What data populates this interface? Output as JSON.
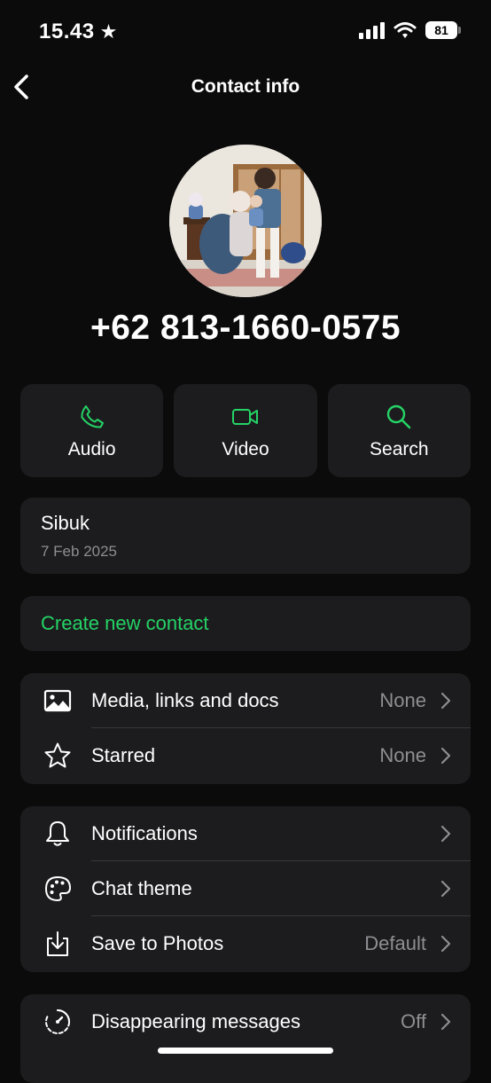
{
  "status_bar": {
    "time": "15.43",
    "battery": "81"
  },
  "nav": {
    "title": "Contact info"
  },
  "profile": {
    "phone": "+62 813-1660-0575"
  },
  "actions": [
    {
      "label": "Audio",
      "icon": "phone-icon"
    },
    {
      "label": "Video",
      "icon": "video-camera-icon"
    },
    {
      "label": "Search",
      "icon": "search-icon"
    }
  ],
  "about": {
    "status": "Sibuk",
    "date": "7 Feb 2025"
  },
  "create_contact": {
    "label": "Create new contact"
  },
  "group1": [
    {
      "label": "Media, links and docs",
      "value": "None",
      "icon": "image-icon"
    },
    {
      "label": "Starred",
      "value": "None",
      "icon": "star-icon"
    }
  ],
  "group2": [
    {
      "label": "Notifications",
      "value": "",
      "icon": "bell-icon"
    },
    {
      "label": "Chat theme",
      "value": "",
      "icon": "palette-icon"
    },
    {
      "label": "Save to Photos",
      "value": "Default",
      "icon": "download-tray-icon"
    }
  ],
  "group3": [
    {
      "label": "Disappearing messages",
      "value": "Off",
      "icon": "timer-icon"
    }
  ],
  "colors": {
    "accent": "#25d366",
    "background": "#0b0b0b",
    "card": "#1c1c1e",
    "secondary_text": "#8e8e93"
  }
}
